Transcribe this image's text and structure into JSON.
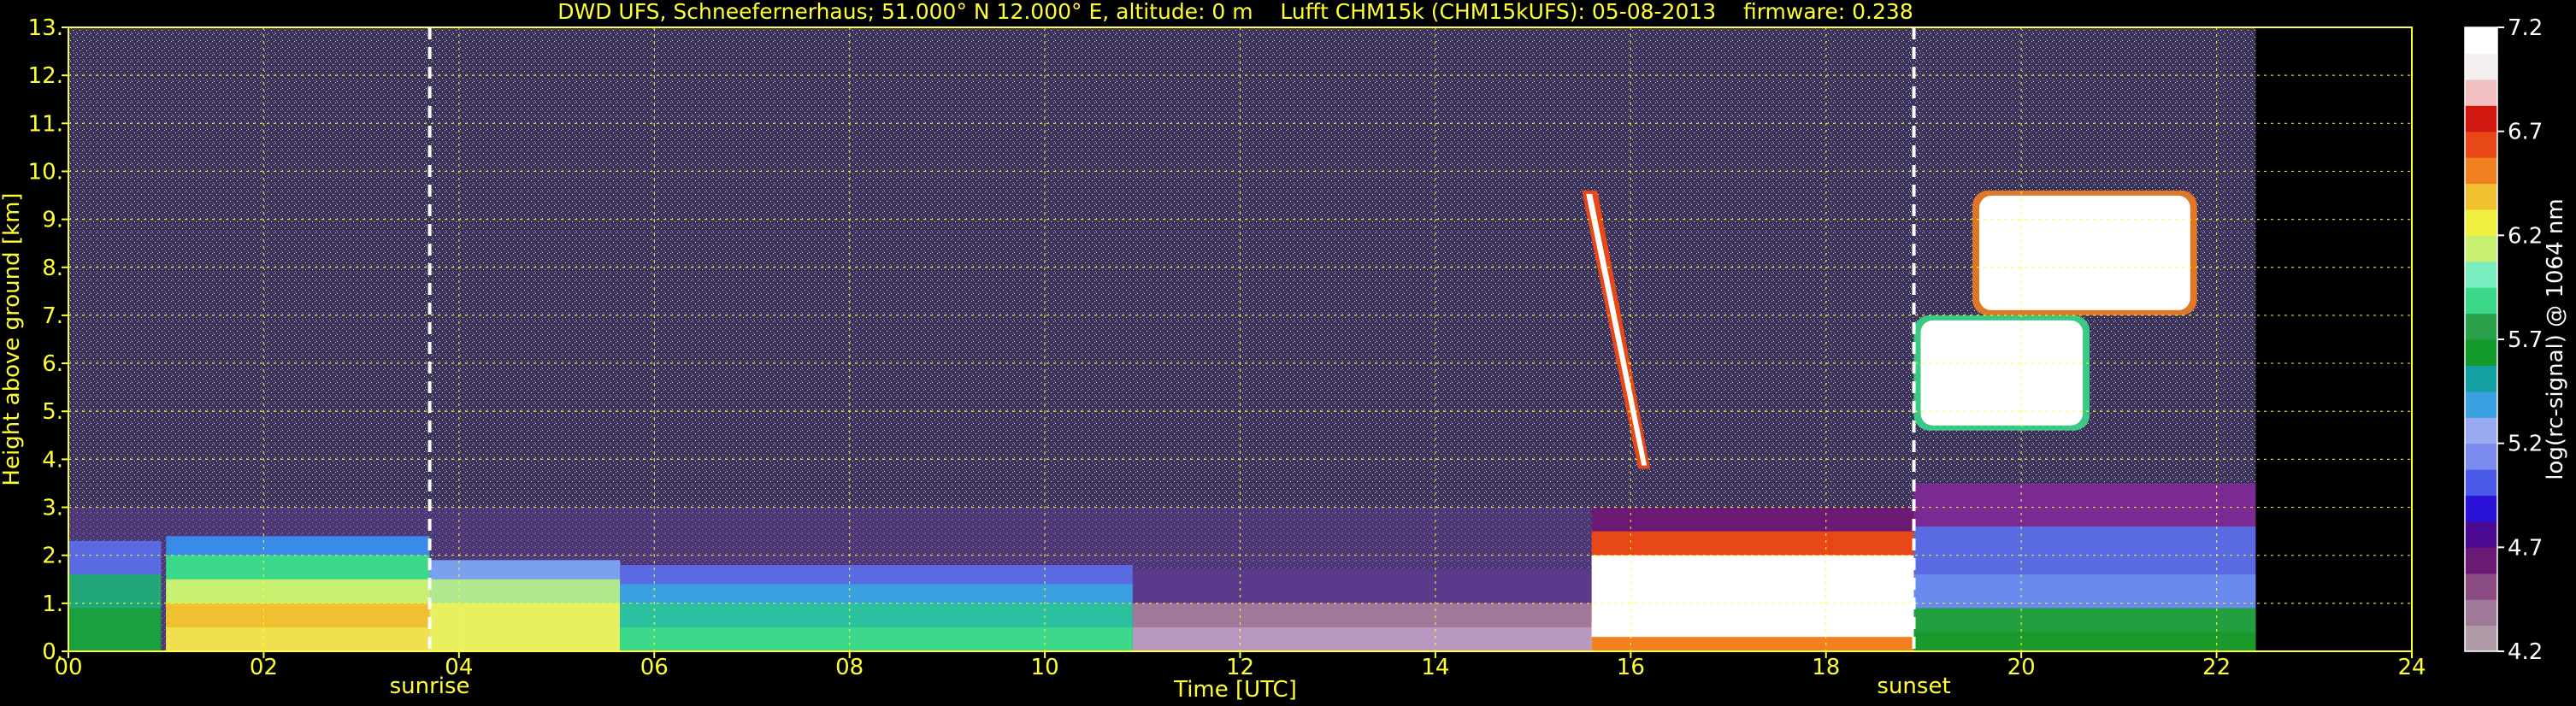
{
  "chart_data": {
    "type": "heatmap",
    "title": "DWD UFS, Schneefernerhaus; 51.000° N 12.000° E, altitude: 0 m    Lufft CHM15k (CHM15kUFS): 05-08-2013    firmware: 0.238",
    "xlabel": "Time [UTC]",
    "ylabel": "Height above ground [km]",
    "x_range": [
      0,
      24
    ],
    "y_range": [
      0,
      13
    ],
    "x_ticks": [
      {
        "value": 0,
        "label": "00"
      },
      {
        "value": 2,
        "label": "02"
      },
      {
        "value": 4,
        "label": "04"
      },
      {
        "value": 6,
        "label": "06"
      },
      {
        "value": 8,
        "label": "08"
      },
      {
        "value": 10,
        "label": "10"
      },
      {
        "value": 12,
        "label": "12"
      },
      {
        "value": 14,
        "label": "14"
      },
      {
        "value": 16,
        "label": "16"
      },
      {
        "value": 18,
        "label": "18"
      },
      {
        "value": 20,
        "label": "20"
      },
      {
        "value": 22,
        "label": "22"
      },
      {
        "value": 24,
        "label": "24"
      }
    ],
    "y_ticks": [
      {
        "value": 0,
        "label": "0."
      },
      {
        "value": 1,
        "label": "1."
      },
      {
        "value": 2,
        "label": "2."
      },
      {
        "value": 3,
        "label": "3."
      },
      {
        "value": 4,
        "label": "4."
      },
      {
        "value": 5,
        "label": "5."
      },
      {
        "value": 6,
        "label": "6."
      },
      {
        "value": 7,
        "label": "7."
      },
      {
        "value": 8,
        "label": "8."
      },
      {
        "value": 9,
        "label": "9."
      },
      {
        "value": 10,
        "label": "10."
      },
      {
        "value": 11,
        "label": "11."
      },
      {
        "value": 12,
        "label": "12."
      },
      {
        "value": 13,
        "label": "13."
      }
    ],
    "grid": true,
    "data_end_time": 22.4,
    "markers": [
      {
        "time": 3.7,
        "label": "sunrise"
      },
      {
        "time": 18.9,
        "label": "sunset"
      }
    ],
    "colorbar": {
      "label": "log(rc-signal) @ 1064 nm",
      "range": [
        4.2,
        7.2
      ],
      "ticks": [
        {
          "value": 4.2,
          "label": "4.2"
        },
        {
          "value": 4.7,
          "label": "4.7"
        },
        {
          "value": 5.2,
          "label": "5.2"
        },
        {
          "value": 5.7,
          "label": "5.7"
        },
        {
          "value": 6.2,
          "label": "6.2"
        },
        {
          "value": 6.7,
          "label": "6.7"
        },
        {
          "value": 7.2,
          "label": "7.2"
        }
      ],
      "colors": [
        "#b09aa8",
        "#a07898",
        "#8a4a82",
        "#6a1a72",
        "#4a0a92",
        "#2a12d8",
        "#4a5ae8",
        "#7a8aee",
        "#9aaaf0",
        "#3aa0e0",
        "#14a0a0",
        "#129a2a",
        "#2aa04a",
        "#3ad888",
        "#7aeec0",
        "#c8f070",
        "#f0f040",
        "#f0c030",
        "#f08020",
        "#e84818",
        "#d01810",
        "#f0c0c0",
        "#f4f0f0",
        "#ffffff"
      ]
    },
    "layers": [
      {
        "start": 0.0,
        "end": 0.95,
        "top": 2.3,
        "description": "boundary layer"
      },
      {
        "start": 1.0,
        "end": 3.7,
        "top": 2.4,
        "description": "boundary layer with strong backscatter"
      },
      {
        "start": 3.7,
        "end": 5.65,
        "top": 1.9,
        "description": "boundary layer"
      },
      {
        "start": 5.65,
        "end": 10.9,
        "top": 1.8,
        "description": "boundary layer"
      },
      {
        "start": 10.9,
        "end": 15.6,
        "top": 1.7,
        "description": "low aerosol layer"
      },
      {
        "start": 15.6,
        "end": 18.9,
        "top": 3.0,
        "description": "cloud layer near ground"
      },
      {
        "start": 18.9,
        "end": 22.4,
        "top": 3.5,
        "description": "boundary layer"
      }
    ],
    "clouds": [
      {
        "start": 15.5,
        "end": 16.2,
        "base": 3.8,
        "top": 9.6,
        "description": "falling streak"
      },
      {
        "start": 18.9,
        "end": 20.7,
        "base": 4.6,
        "top": 7.0,
        "description": "mid-level cloud"
      },
      {
        "start": 19.5,
        "end": 21.8,
        "base": 7.0,
        "top": 9.6,
        "description": "upper cloud"
      }
    ]
  }
}
